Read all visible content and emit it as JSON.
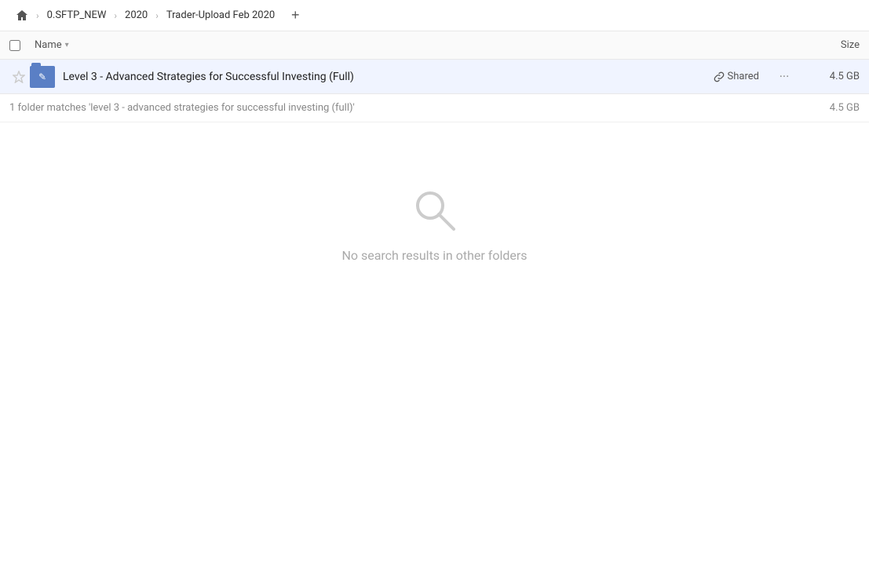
{
  "breadcrumb": {
    "home_label": "Home",
    "items": [
      {
        "label": "0.SFTP_NEW"
      },
      {
        "label": "2020"
      },
      {
        "label": "Trader-Upload Feb 2020"
      }
    ],
    "add_button_label": "+"
  },
  "column_header": {
    "name_label": "Name",
    "size_label": "Size"
  },
  "file_row": {
    "name": "Level 3 - Advanced Strategies for Successful Investing (Full)",
    "shared_label": "Shared",
    "size": "4.5 GB",
    "more_label": "···"
  },
  "search_info": {
    "text": "1 folder matches 'level 3 - advanced strategies for successful investing (full)'",
    "size": "4.5 GB"
  },
  "no_results": {
    "text": "No search results in other folders"
  }
}
